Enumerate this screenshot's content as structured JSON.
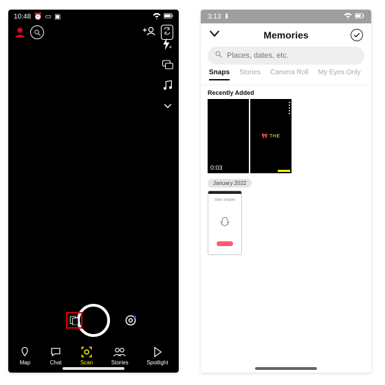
{
  "left": {
    "status_time": "10:48",
    "nav": {
      "map": "Map",
      "chat": "Chat",
      "scan": "Scan",
      "stories": "Stories",
      "spotlight": "Spotlight"
    }
  },
  "right": {
    "status_time": "3:13",
    "title": "Memories",
    "search_placeholder": "Places, dates, etc.",
    "tabs": {
      "snaps": "Snaps",
      "stories": "Stories",
      "camera_roll": "Camera Roll",
      "my_eyes_only": "My Eyes Only"
    },
    "section_recent": "Recently Added",
    "tile1_duration": "0:03",
    "tile2_label": "THE",
    "month": "January 2022",
    "camroll_caption": "Story Snippet"
  }
}
